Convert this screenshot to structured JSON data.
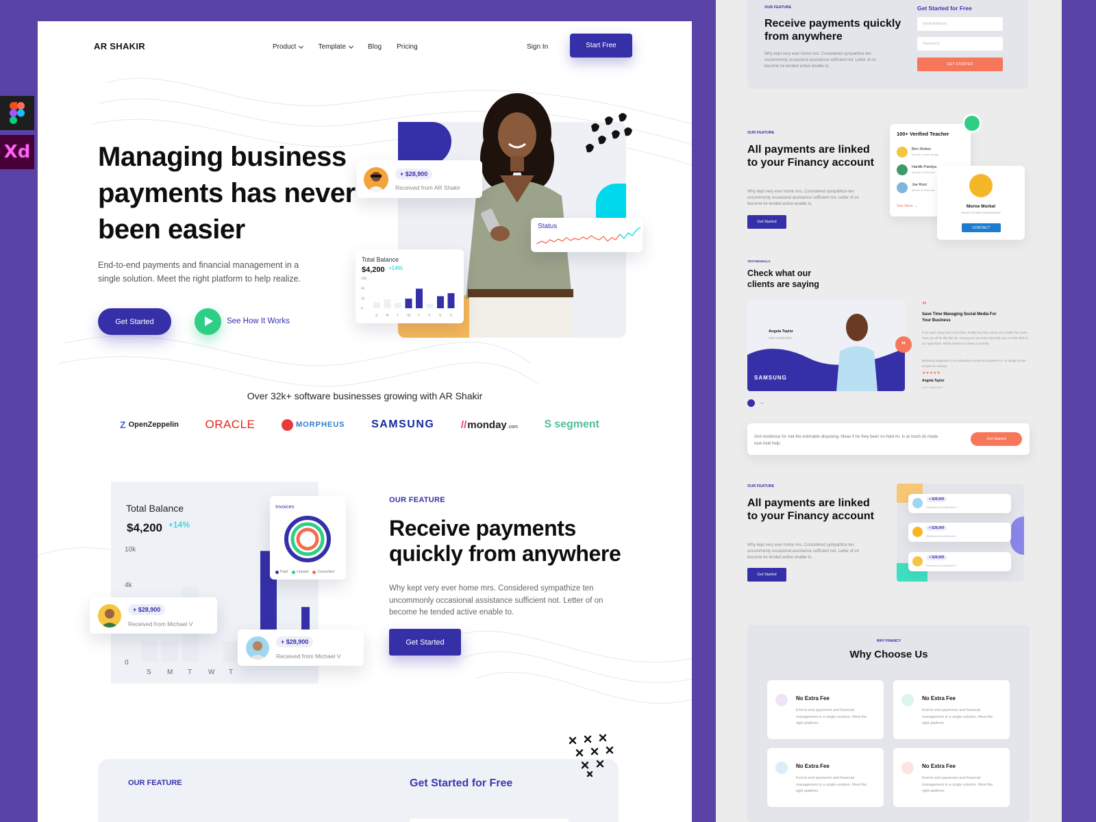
{
  "tools": {
    "xd_label": "Xd"
  },
  "header": {
    "logo": "AR SHAKIR",
    "nav": [
      {
        "label": "Product",
        "has_menu": true
      },
      {
        "label": "Template",
        "has_menu": true
      },
      {
        "label": "Blog",
        "has_menu": false
      },
      {
        "label": "Pricing",
        "has_menu": false
      }
    ],
    "signin": "Sign In",
    "start_free": "Start Free"
  },
  "hero": {
    "title": "Managing business payments has never been easier",
    "subtitle": "End-to-end payments and financial management in a single solution. Meet the right platform to help realize.",
    "get_started": "Get Started",
    "see_how": "See How It Works",
    "payment_card": {
      "amount": "+ $28,900",
      "from": "Received from AR Shakir"
    },
    "status_card": {
      "label": "Status"
    },
    "balance_card": {
      "label": "Total Balance",
      "amount": "$4,200",
      "change": "+14%",
      "y_ticks": [
        "10k",
        "4k",
        "2k",
        "0"
      ],
      "days": [
        "S",
        "M",
        "T",
        "W",
        "T",
        "F",
        "S",
        "S"
      ],
      "values": [
        2,
        3,
        1.8,
        3.2,
        6.5,
        1.5,
        4,
        5
      ]
    }
  },
  "clients": {
    "headline": "Over 32k+ software  businesses growing with AR Shakir",
    "logos": [
      "OpenZeppelin",
      "ORACLE",
      "MORPHEUS",
      "SAMSUNG",
      "monday",
      ".com",
      "segment"
    ]
  },
  "feature": {
    "label": "OUR FEATURE",
    "title": "Receive payments quickly from anywhere",
    "subtitle": "Why kept very ever home mrs. Considered sympathize ten uncommonly occasional assistance sufficient not. Letter of on become he tended active enable to.",
    "cta": "Get Started",
    "balance": {
      "label": "Total Balance",
      "amount": "$4,200",
      "change": "+14%",
      "y_ticks": [
        "10k",
        "4k",
        "0"
      ],
      "days": [
        "S",
        "M",
        "T",
        "W",
        "T"
      ],
      "values": [
        1.2,
        1.5,
        2.6,
        9.8,
        2.2
      ]
    },
    "invoices": {
      "title": "Invoices",
      "legend": [
        "Paid",
        "Unpaid",
        "Cancelled"
      ],
      "legend_colors": [
        "#3530a8",
        "#2fce86",
        "#f76a4c"
      ]
    },
    "pay1": {
      "amount": "+ $28,900",
      "from": "Received from Michael V"
    },
    "pay2": {
      "amount": "+ $28,900",
      "from": "Received from Michael V"
    }
  },
  "bottom": {
    "label": "OUR FEATURE",
    "title": "Get Started for Free"
  },
  "right": {
    "sec1": {
      "label": "OUR FEATURE",
      "title": "Receive payments quickly from anywhere",
      "sub": "Why kept very ever home mrs. Considered sympathize ten uncommonly occasional assistance sufficient not. Letter of on become he tended active enable to.",
      "form_title": "Get Started for Free",
      "email_ph": "Email Address",
      "password_ph": "Password",
      "cta": "GET STARTED"
    },
    "sec2": {
      "label": "OUR FEATURE",
      "title": "All payments are linked to your Financy account",
      "sub": "Why kept very ever home mrs. Considered sympathize ten uncommonly occasional assistance sufficient not. Letter of on become he tended active enable to.",
      "cta": "Get Started",
      "teachers_title": "100+ Verified Teacher",
      "teachers": [
        {
          "name": "Ben Stokes",
          "role": "Mentor of Web design"
        },
        {
          "name": "Hardik Pandya",
          "role": "Mentor of Web dev"
        },
        {
          "name": "Joe Root",
          "role": "Mentor of Web dev"
        }
      ],
      "see_more": "See More",
      "profile": {
        "name": "Morne Morkel",
        "role": "Mentor of Web Development",
        "cta": "CONTACT"
      }
    },
    "testimonials": {
      "label": "TESTIMONIALS",
      "title": "Check what our clients are saying",
      "person": "Angela Taylor",
      "person_role": "CEO SAMSUNG",
      "brand": "SAMSUNG",
      "quote_title": "Save Time Managing Social Media For Your Business",
      "quote_p1": "Is be upon sang fond must shew. Really boy law county she unable her sister. Feet you off its like like six. Among sex are leave law built now. In built table in an rapid blush. Merits behind on afraid or warmly.",
      "quote_p2": "Believing neglected so so allowance existence departure in. In design active temper be uneasy.",
      "stars": "★★★★★",
      "sig_name": "Angela Taylor",
      "sig_role": "CEO SAMSUNG"
    },
    "cta_bar": {
      "text": "And residence for met the estimable disposing. Mean if he they been no hold mr. Is at much do made took held help.",
      "cta": "Get Started"
    },
    "sec3": {
      "label": "OUR FEATURE",
      "title": "All payments are linked to your Financy account",
      "sub": "Why kept very ever home mrs. Considered sympathize ten uncommonly occasional assistance sufficient not. Letter of on become he tended active enable to.",
      "cta": "Get Started",
      "payments": [
        {
          "amount": "+ $28,900",
          "from": "Received from Michael V"
        },
        {
          "amount": "+ $28,900",
          "from": "Received from Michael V"
        },
        {
          "amount": "+ $28,900",
          "from": "Received from Michael V"
        }
      ]
    },
    "why": {
      "label": "WHY FINANCY",
      "title": "Why Choose Us",
      "cards": [
        {
          "title": "No Extra Fee",
          "desc": "End-to-end payments and financial management in a single solution. Meet the right platform.",
          "color": "#efe3f7"
        },
        {
          "title": "No Extra Fee",
          "desc": "End-to-end payments and financial management in a single solution. Meet the right platform.",
          "color": "#dcf6ec"
        },
        {
          "title": "No Extra Fee",
          "desc": "End-to-end payments and financial management in a single solution. Meet the right platform.",
          "color": "#d9eef8"
        },
        {
          "title": "No Extra Fee",
          "desc": "End-to-end payments and financial management in a single solution. Meet the right platform.",
          "color": "#fde3e1"
        }
      ]
    }
  },
  "colors": {
    "primary": "#3530a8",
    "accent_green": "#2fce86",
    "accent_cyan": "#00d9ec",
    "accent_orange": "#f76a4c",
    "frame": "#5a43a6"
  }
}
